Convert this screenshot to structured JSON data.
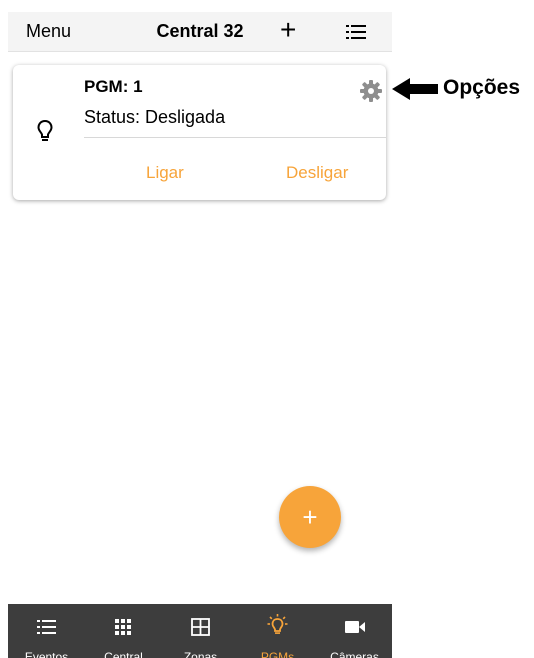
{
  "nav": {
    "menu": "Menu",
    "title": "Central 32",
    "add": "+"
  },
  "card": {
    "title": "PGM: 1",
    "status": "Status: Desligada",
    "on_label": "Ligar",
    "off_label": "Desligar"
  },
  "annotation": {
    "label": "Opções"
  },
  "fab": {
    "label": "+"
  },
  "tabs": [
    {
      "label": "Eventos",
      "icon": "list-icon"
    },
    {
      "label": "Central",
      "icon": "grid-icon"
    },
    {
      "label": "Zonas",
      "icon": "zones-icon"
    },
    {
      "label": "PGMs",
      "icon": "bulb-icon",
      "active": true
    },
    {
      "label": "Câmeras",
      "icon": "camera-icon"
    }
  ],
  "colors": {
    "accent": "#f7a43a",
    "tabbar": "#3d3d3d",
    "navbar": "#f4f4f4"
  }
}
